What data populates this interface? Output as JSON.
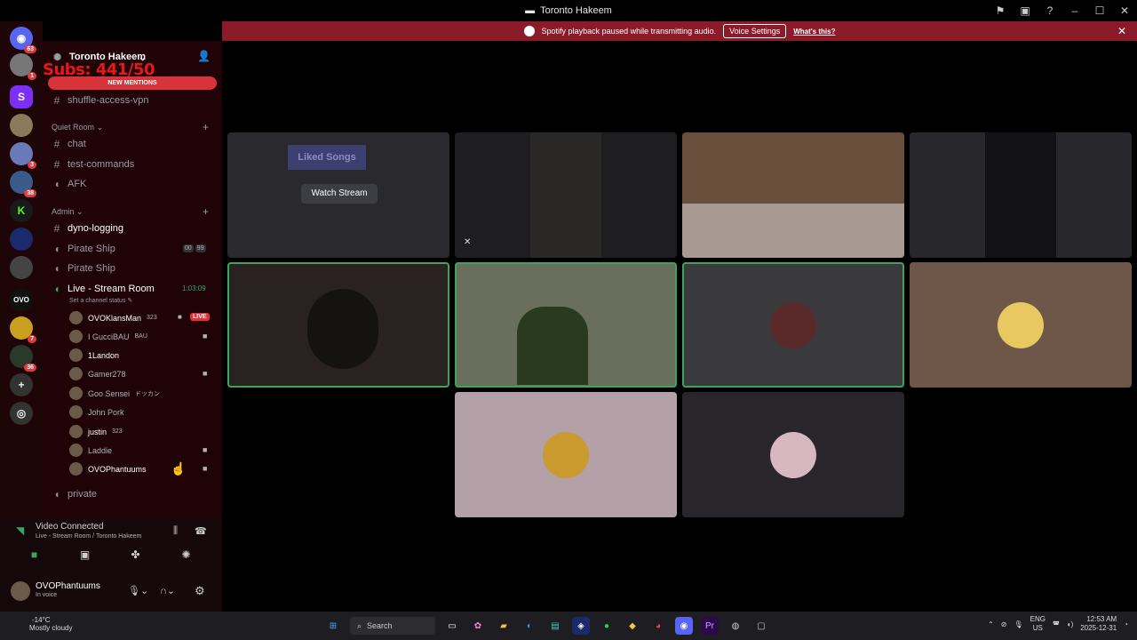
{
  "window": {
    "title": "Toronto Hakeem"
  },
  "notice": {
    "text": "Spotify playback paused while transmitting audio.",
    "voice_settings": "Voice Settings",
    "whats_this": "What's this?"
  },
  "servers": {
    "badges": [
      "63",
      "1",
      "3",
      "38",
      "7",
      "36"
    ]
  },
  "sidebar": {
    "server_name": "Toronto Hakeem",
    "overlay_text": "Subs: 441/50",
    "new_mentions": "NEW MENTIONS",
    "channels_top": [
      "shuffle-access-vpn"
    ],
    "quiet_room": {
      "label": "Quiet Room",
      "channels": [
        "chat",
        "test-commands",
        "AFK"
      ]
    },
    "admin": {
      "label": "Admin",
      "channels": [
        "dyno-logging",
        "Pirate Ship",
        "Pirate Ship"
      ],
      "pirate_counts": [
        "00",
        "99"
      ]
    },
    "live_room": {
      "name": "Live - Stream Room",
      "timer": "1:03:09",
      "status_hint": "Set a channel status"
    },
    "voice_users": [
      {
        "name": "OVOKlansMan",
        "tag": "323",
        "live": "LIVE"
      },
      {
        "name": "I GucciBAU",
        "tag": "BAU"
      },
      {
        "name": "1Landon",
        "tag": ""
      },
      {
        "name": "Gamer278",
        "tag": ""
      },
      {
        "name": "Goo Sensei",
        "tag": "ドッカン"
      },
      {
        "name": "John Pork",
        "tag": ""
      },
      {
        "name": "justin",
        "tag": "323"
      },
      {
        "name": "Laddie",
        "tag": ""
      },
      {
        "name": "OVOPhantuums",
        "tag": ""
      }
    ],
    "private_channel": "private"
  },
  "voice_panel": {
    "status": "Video Connected",
    "location": "Live - Stream Room / Toronto Hakeem"
  },
  "user": {
    "name": "OVOPhantuums",
    "status": "In voice"
  },
  "stage": {
    "watch_stream": "Watch Stream",
    "stream_preview_title": "Liked Songs",
    "tiles": [
      {
        "id": "stream-preview",
        "color": "#2a2a2e"
      },
      {
        "id": "cam-1",
        "color": "#1e1e20"
      },
      {
        "id": "cam-2",
        "color": "#6a4e3c"
      },
      {
        "id": "cam-3",
        "color": "#28282c"
      },
      {
        "id": "cam-4",
        "color": "#2a2220",
        "speaking": true
      },
      {
        "id": "cam-5",
        "color": "#6a6e5c",
        "speaking": true
      },
      {
        "id": "avatar-1",
        "color": "#3a3a3c",
        "speaking": true
      },
      {
        "id": "avatar-2",
        "color": "#6e5648"
      },
      {
        "id": "avatar-3",
        "color": "#b4a1a8"
      },
      {
        "id": "avatar-4",
        "color": "#28262a"
      }
    ]
  },
  "taskbar": {
    "temp": "-14°C",
    "weather": "Mostly cloudy",
    "search": "Search",
    "lang": "ENG",
    "region": "US",
    "time": "12:53 AM",
    "date": "2025-12-31"
  }
}
